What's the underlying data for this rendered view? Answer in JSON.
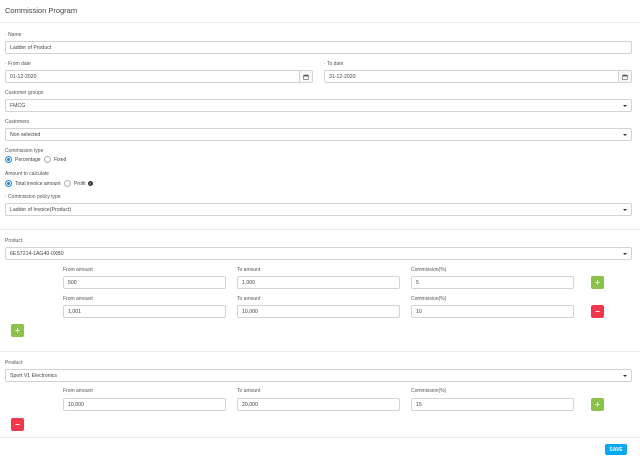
{
  "page_title": "Commission Program",
  "form": {
    "name_label": "· Name",
    "name_value": "Ladder of Product",
    "from_date_label": "· From date",
    "from_date_value": "01-12-2020",
    "to_date_label": "· To date",
    "to_date_value": "31-12-2020",
    "customer_groups_label": "Customer groups",
    "customer_groups_value": "FMCG",
    "customers_label": "Customers",
    "customers_value": "Non selected",
    "commission_type_label": "Commission type",
    "commission_type_options": [
      "Percentage",
      "Fixed"
    ],
    "commission_type_selected": "Percentage",
    "amount_label": "Amount to calculate",
    "amount_options": [
      "Total invoice amount",
      "Profit"
    ],
    "amount_selected": "Total invoice amount",
    "policy_label": "· Commission policy type",
    "policy_value": "Ladder of Invoice(Product)"
  },
  "columns": {
    "from": "From amount",
    "to": "To amount",
    "commission": "Commission(%)"
  },
  "product_label": "Product",
  "products": [
    {
      "name": "6ES7214-1AG40-0XB0",
      "rows": [
        {
          "from": "500",
          "to": "1,000",
          "commission": "5"
        },
        {
          "from": "1,001",
          "to": "10,000",
          "commission": "10"
        }
      ]
    },
    {
      "name": "Sport V1 Electronics",
      "rows": [
        {
          "from": "10,000",
          "to": "20,000",
          "commission": "15"
        }
      ]
    }
  ],
  "buttons": {
    "add_symbol": "+",
    "remove_symbol": "−",
    "save_label": "SAVE"
  },
  "colors": {
    "accent_blue": "#03a9f4",
    "add_green": "#8bc34a",
    "remove_red": "#f4364c"
  },
  "icons": {
    "calendar": "calendar-icon",
    "help": "question-circle-icon"
  }
}
